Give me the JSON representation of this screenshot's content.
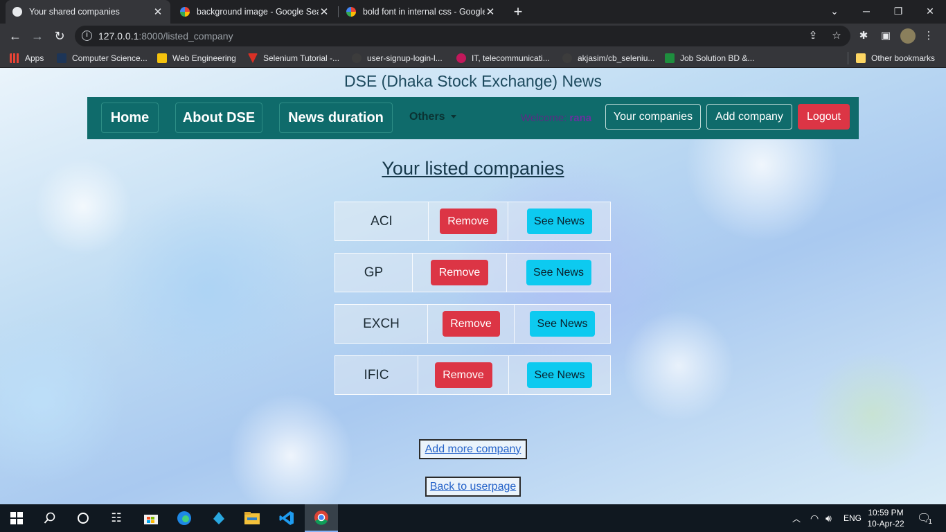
{
  "browser": {
    "tabs": [
      {
        "title": "Your shared companies",
        "active": true
      },
      {
        "title": "background image - Google Sear",
        "active": false
      },
      {
        "title": "bold font in internal css - Google",
        "active": false
      }
    ],
    "url_host": "127.0.0.1",
    "url_rest": ":8000/listed_company",
    "bookmarks": [
      "Apps",
      "Computer Science...",
      "Web Engineering",
      "Selenium Tutorial -...",
      "user-signup-login-l...",
      "IT, telecommunicati...",
      "akjasim/cb_seleniu...",
      "Job Solution BD &..."
    ],
    "other_bookmarks": "Other bookmarks"
  },
  "page": {
    "site_title": "DSE (Dhaka Stock Exchange) News",
    "nav": {
      "home": "Home",
      "about": "About DSE",
      "news_duration": "News duration",
      "others": "Others",
      "welcome": "Welcome:",
      "username": "rana",
      "your_companies": "Your companies",
      "add_company": "Add company",
      "logout": "Logout"
    },
    "heading": "Your listed companies",
    "companies": [
      {
        "name": "ACI",
        "remove": "Remove",
        "news": "See News"
      },
      {
        "name": "GP",
        "remove": "Remove",
        "news": "See News"
      },
      {
        "name": "EXCH",
        "remove": "Remove",
        "news": "See News"
      },
      {
        "name": "IFIC",
        "remove": "Remove",
        "news": "See News"
      }
    ],
    "add_more": "Add more company",
    "back": "Back to userpage"
  },
  "taskbar": {
    "language": "ENG",
    "time": "10:59 PM",
    "date": "10-Apr-22",
    "notifications": "1"
  },
  "colors": {
    "navbar": "#0f6b6b",
    "danger": "#dc3545",
    "info": "#0dcaf0"
  }
}
